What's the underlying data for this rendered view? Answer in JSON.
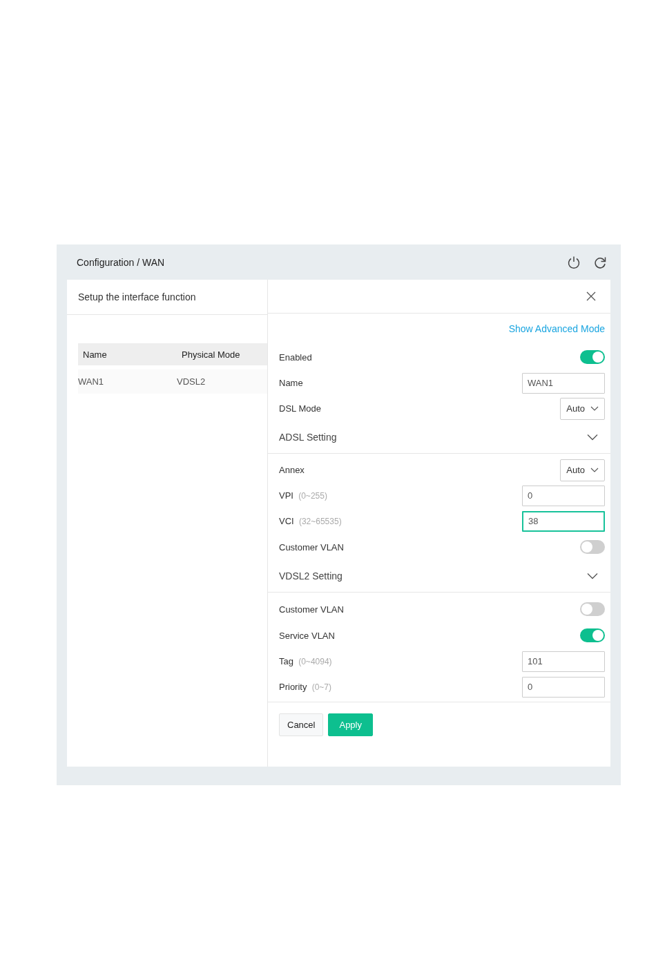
{
  "breadcrumb": "Configuration / WAN",
  "left_panel": {
    "title": "Setup the interface function",
    "table": {
      "columns": [
        "Name",
        "Physical Mode"
      ],
      "rows": [
        [
          "WAN1",
          "VDSL2"
        ]
      ]
    }
  },
  "right_panel": {
    "advanced_link": "Show Advanced Mode",
    "rows": [
      {
        "kind": "toggle",
        "label": "Enabled",
        "on": true
      },
      {
        "kind": "input",
        "label": "Name",
        "value": "WAN1",
        "focused": false
      },
      {
        "kind": "select",
        "label": "DSL Mode",
        "value": "Auto"
      }
    ],
    "sections": [
      {
        "title": "ADSL Setting",
        "rows": [
          {
            "kind": "select",
            "label": "Annex",
            "value": "Auto"
          },
          {
            "kind": "input",
            "label": "VPI",
            "hint": "(0~255)",
            "value": "0",
            "focused": false
          },
          {
            "kind": "input",
            "label": "VCI",
            "hint": "(32~65535)",
            "value": "38",
            "focused": true
          },
          {
            "kind": "toggle",
            "label": "Customer VLAN",
            "on": false
          }
        ]
      },
      {
        "title": "VDSL2 Setting",
        "rows": [
          {
            "kind": "toggle",
            "label": "Customer VLAN",
            "on": false
          },
          {
            "kind": "toggle",
            "label": "Service VLAN",
            "on": true
          },
          {
            "kind": "input",
            "label": "Tag",
            "hint": "(0~4094)",
            "value": "101",
            "focused": false
          },
          {
            "kind": "input",
            "label": "Priority",
            "hint": "(0~7)",
            "value": "0",
            "focused": false
          }
        ]
      }
    ],
    "buttons": [
      {
        "label": "Cancel",
        "primary": false
      },
      {
        "label": "Apply",
        "primary": true
      }
    ]
  }
}
